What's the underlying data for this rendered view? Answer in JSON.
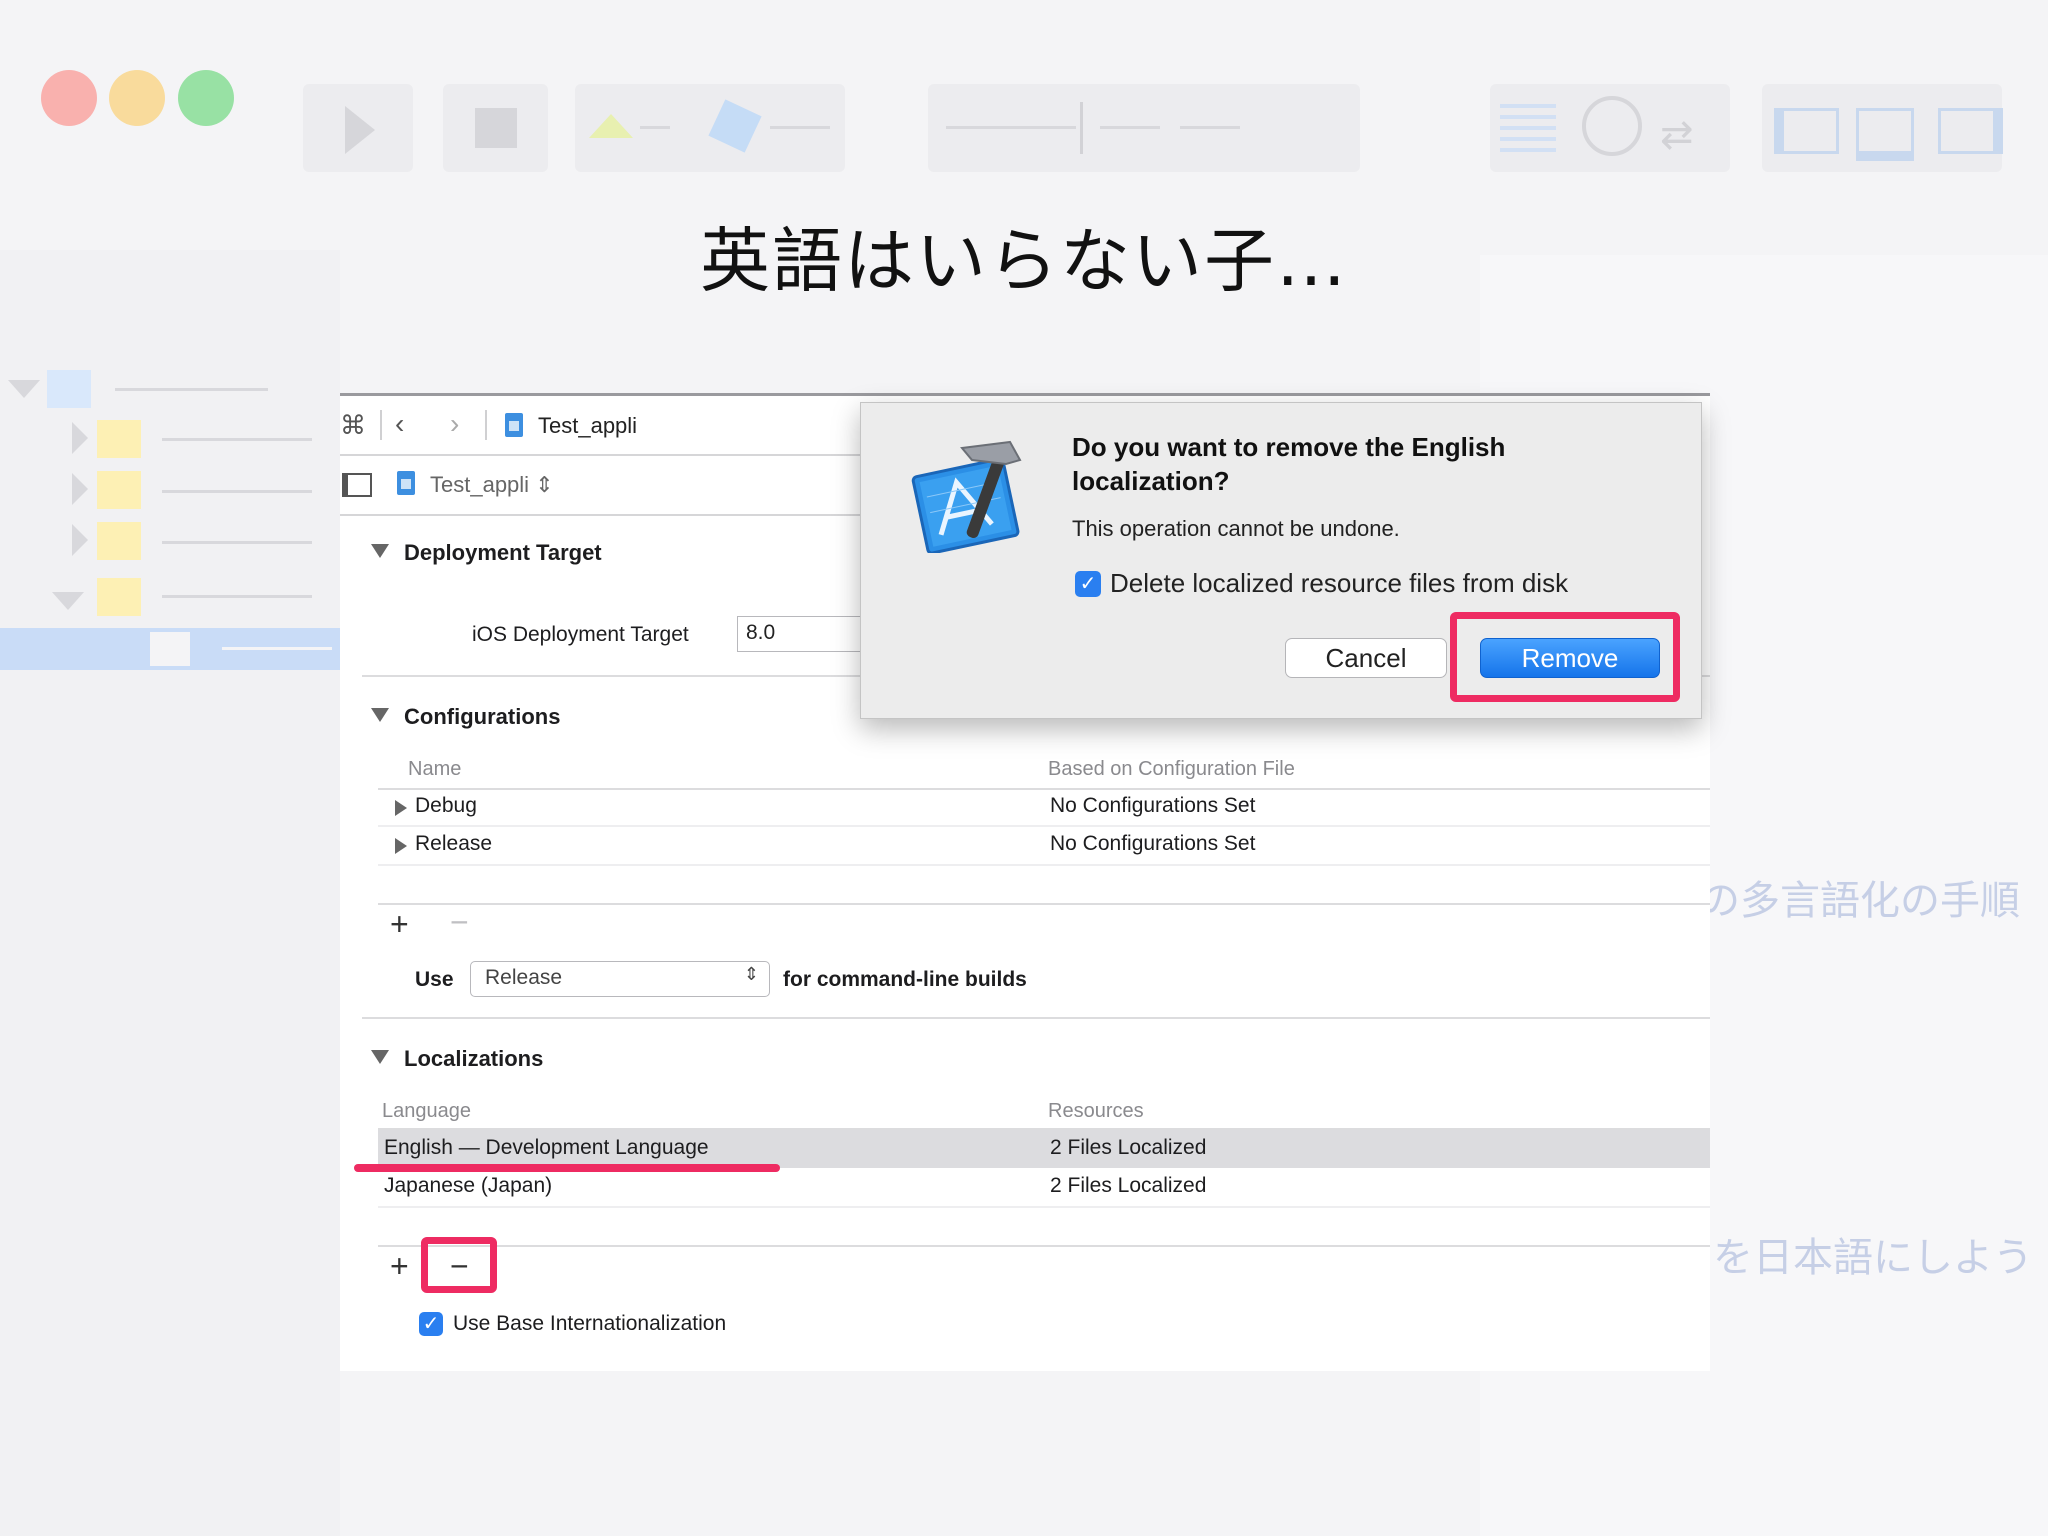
{
  "slide_title": "英語はいらない子…",
  "background_hints": {
    "right_text_1": "の多言語化の手順",
    "right_text_2": "を日本語にしよう"
  },
  "jump_bar": {
    "file_name": "Test_appli",
    "target_name": "Test_appli"
  },
  "deployment": {
    "header": "Deployment Target",
    "ios_label": "iOS Deployment Target",
    "ios_value": "8.0"
  },
  "configurations": {
    "header": "Configurations",
    "col_name": "Name",
    "col_based_on": "Based on Configuration File",
    "rows": [
      {
        "name": "Debug",
        "value": "No Configurations Set"
      },
      {
        "name": "Release",
        "value": "No Configurations Set"
      }
    ],
    "use_label": "Use",
    "use_value": "Release",
    "use_suffix": "for command-line builds"
  },
  "localizations": {
    "header": "Localizations",
    "col_language": "Language",
    "col_resources": "Resources",
    "rows": [
      {
        "language": "English — Development Language",
        "resources": "2 Files Localized"
      },
      {
        "language": "Japanese (Japan)",
        "resources": "2 Files Localized"
      }
    ],
    "base_i18n_label": "Use Base Internationalization"
  },
  "dialog": {
    "title_line1": "Do you want to remove the English",
    "title_line2": "localization?",
    "message": "This operation cannot be undone.",
    "checkbox_label": "Delete localized resource files from disk",
    "cancel_label": "Cancel",
    "remove_label": "Remove"
  },
  "colors": {
    "highlight": "#ee2b62",
    "accent_blue": "#1574ea"
  }
}
